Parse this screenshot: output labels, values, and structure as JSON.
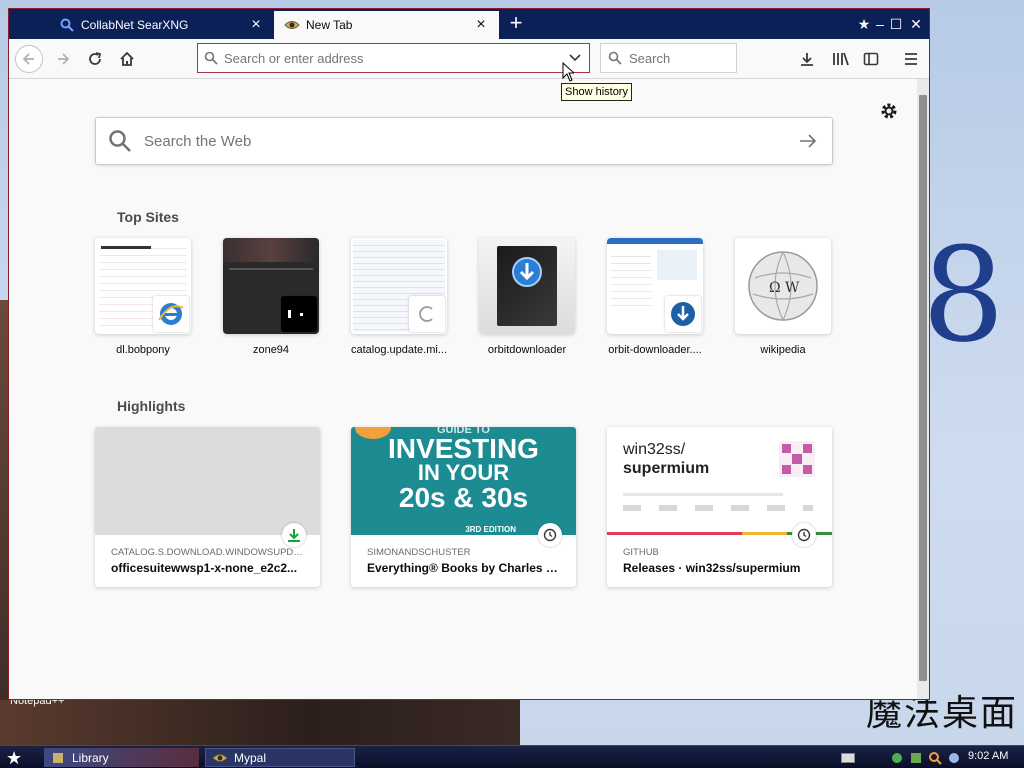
{
  "tabs": [
    {
      "title": "CollabNet SearXNG"
    },
    {
      "title": "New Tab"
    }
  ],
  "urlbar": {
    "placeholder": "Search or enter address"
  },
  "searchbar": {
    "placeholder": "Search"
  },
  "tooltip": {
    "text": "Show history"
  },
  "web_search": {
    "placeholder": "Search the Web"
  },
  "top_sites": {
    "heading": "Top Sites",
    "items": [
      {
        "title": "dl.bobpony"
      },
      {
        "title": "zone94"
      },
      {
        "title": "catalog.update.mi..."
      },
      {
        "title": "orbitdownloader"
      },
      {
        "title": "orbit-downloader...."
      },
      {
        "title": "wikipedia"
      }
    ]
  },
  "highlights": {
    "heading": "Highlights",
    "items": [
      {
        "source": "CATALOG.S.DOWNLOAD.WINDOWSUPDA...",
        "title": "officesuitewwsp1-x-none_e2c2...",
        "badge": "download-icon"
      },
      {
        "source": "SIMONANDSCHUSTER",
        "title": "Everything® Books by Charles Ti...",
        "badge": "clock-icon",
        "image_text": [
          "GUIDE TO",
          "INVESTING",
          "IN YOUR",
          "20s & 30s",
          "3RD EDITION"
        ]
      },
      {
        "source": "GITHUB",
        "title": "Releases · win32ss/supermium",
        "badge": "clock-icon",
        "image_text": [
          "win32ss/",
          "supermium"
        ]
      }
    ]
  },
  "taskbar": {
    "items": [
      {
        "label": "Library"
      },
      {
        "label": "Mypal"
      }
    ],
    "clock": "9:02 AM"
  },
  "desktop": {
    "notepad_label": "Notepad++"
  },
  "colors": {
    "tab_bar": "#0c2058",
    "accent_border": "#a8344a",
    "book_cover": "#1d8c92"
  }
}
